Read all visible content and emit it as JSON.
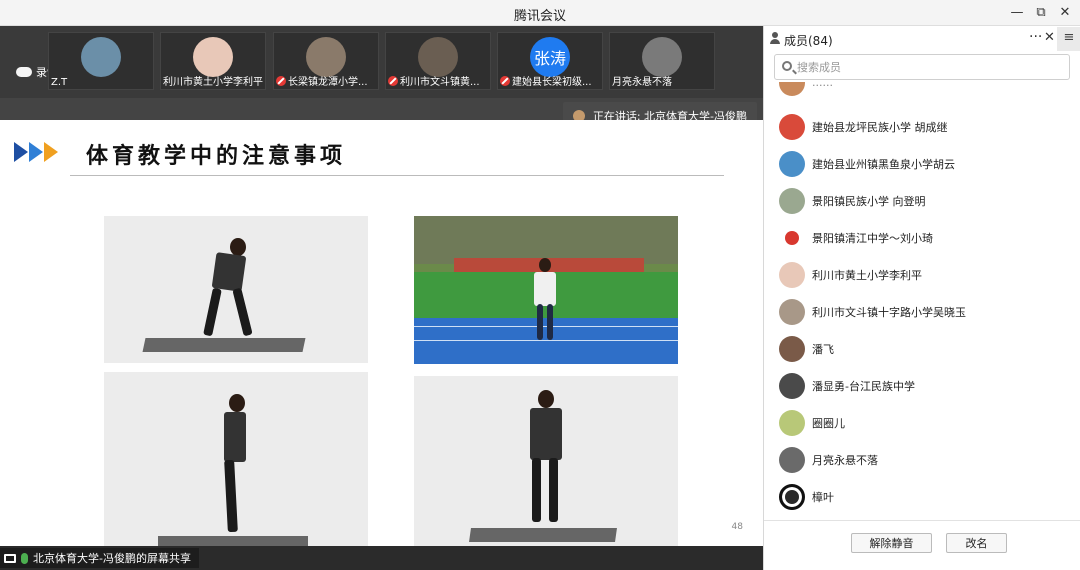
{
  "window": {
    "title": "腾讯会议",
    "controls": {
      "minimize": "—",
      "restore": "⧉",
      "close": "✕"
    }
  },
  "recording": {
    "label": "录制中"
  },
  "participants": [
    {
      "name": "Z.T",
      "avatar_color": "#6b8fa8",
      "muted": false
    },
    {
      "name": "利川市黄土小学李利平",
      "avatar_color": "#e8c8b8",
      "muted": false
    },
    {
      "name": "长梁镇龙潭小学...",
      "avatar_color": "#8a7a6a",
      "muted": true
    },
    {
      "name": "利川市文斗镇黄...",
      "avatar_color": "#6a5e52",
      "muted": true
    },
    {
      "name": "建始县长梁初级...",
      "avatar_text": "张涛",
      "avatar_color": "#1f7bf0",
      "muted": true
    },
    {
      "name": "月亮永悬不落",
      "avatar_color": "#7a7a7a",
      "muted": false
    }
  ],
  "speaking": {
    "label": "正在讲话: 北京体育大学-冯俊鹏"
  },
  "slide": {
    "title": "体育教学中的注意事项",
    "page_number": "48"
  },
  "share": {
    "label": "北京体育大学-冯俊鹏的屏幕共享"
  },
  "panel": {
    "title": "成员(84)",
    "more": "···",
    "close": "✕",
    "menu": "≡",
    "search_placeholder": "搜索成员",
    "members": [
      {
        "name": "......",
        "avatar_color": "#c98a5c",
        "partial": true
      },
      {
        "name": "建始县龙坪民族小学  胡成继",
        "avatar_color": "#d94a3a"
      },
      {
        "name": "建始县业州镇黑鱼泉小学胡云",
        "avatar_color": "#4a8fc8"
      },
      {
        "name": "景阳镇民族小学  向登明",
        "avatar_color": "#9aa890"
      },
      {
        "name": "景阳镇清江中学～刘小琦",
        "avatar_color": "#d8382f"
      },
      {
        "name": "利川市黄土小学李利平",
        "avatar_color": "#e8c8b8"
      },
      {
        "name": "利川市文斗镇十字路小学吴晓玉",
        "avatar_color": "#a89888"
      },
      {
        "name": "潘飞",
        "avatar_color": "#7a5a48"
      },
      {
        "name": "潘显勇-台江民族中学",
        "avatar_color": "#4a4a4a"
      },
      {
        "name": "圈圈儿",
        "avatar_color": "#b8c878"
      },
      {
        "name": "月亮永悬不落",
        "avatar_color": "#6a6a6a"
      },
      {
        "name": "樟叶",
        "avatar_color": "#2a2a2a"
      }
    ],
    "buttons": {
      "unmute": "解除静音",
      "rename": "改名"
    }
  }
}
